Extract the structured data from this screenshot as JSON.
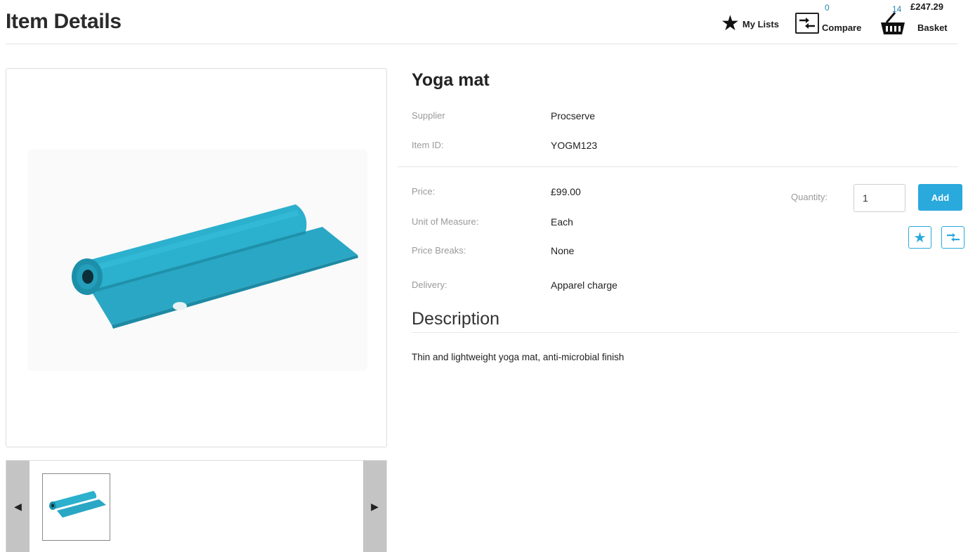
{
  "header": {
    "title": "Item Details",
    "my_lists_label": "My Lists",
    "compare_label": "Compare",
    "compare_count": "0",
    "basket_label": "Basket",
    "basket_count": "14",
    "basket_total": "£247.29"
  },
  "product": {
    "name": "Yoga mat",
    "supplier_label": "Supplier",
    "supplier": "Procserve",
    "item_id_label": "Item ID:",
    "item_id": "YOGM123",
    "price_label": "Price:",
    "price": "£99.00",
    "uom_label": "Unit of Measure:",
    "uom": "Each",
    "price_breaks_label": "Price Breaks:",
    "price_breaks": "None",
    "delivery_label": "Delivery:",
    "delivery": "Apparel charge"
  },
  "purchase": {
    "quantity_label": "Quantity:",
    "quantity_value": "1",
    "add_label": "Add"
  },
  "description": {
    "heading": "Description",
    "text": "Thin and lightweight yoga mat, anti-microbial finish"
  },
  "colors": {
    "accent": "#2aa9dc",
    "mat": "#27a9c6",
    "link_count": "#2a86b6"
  }
}
